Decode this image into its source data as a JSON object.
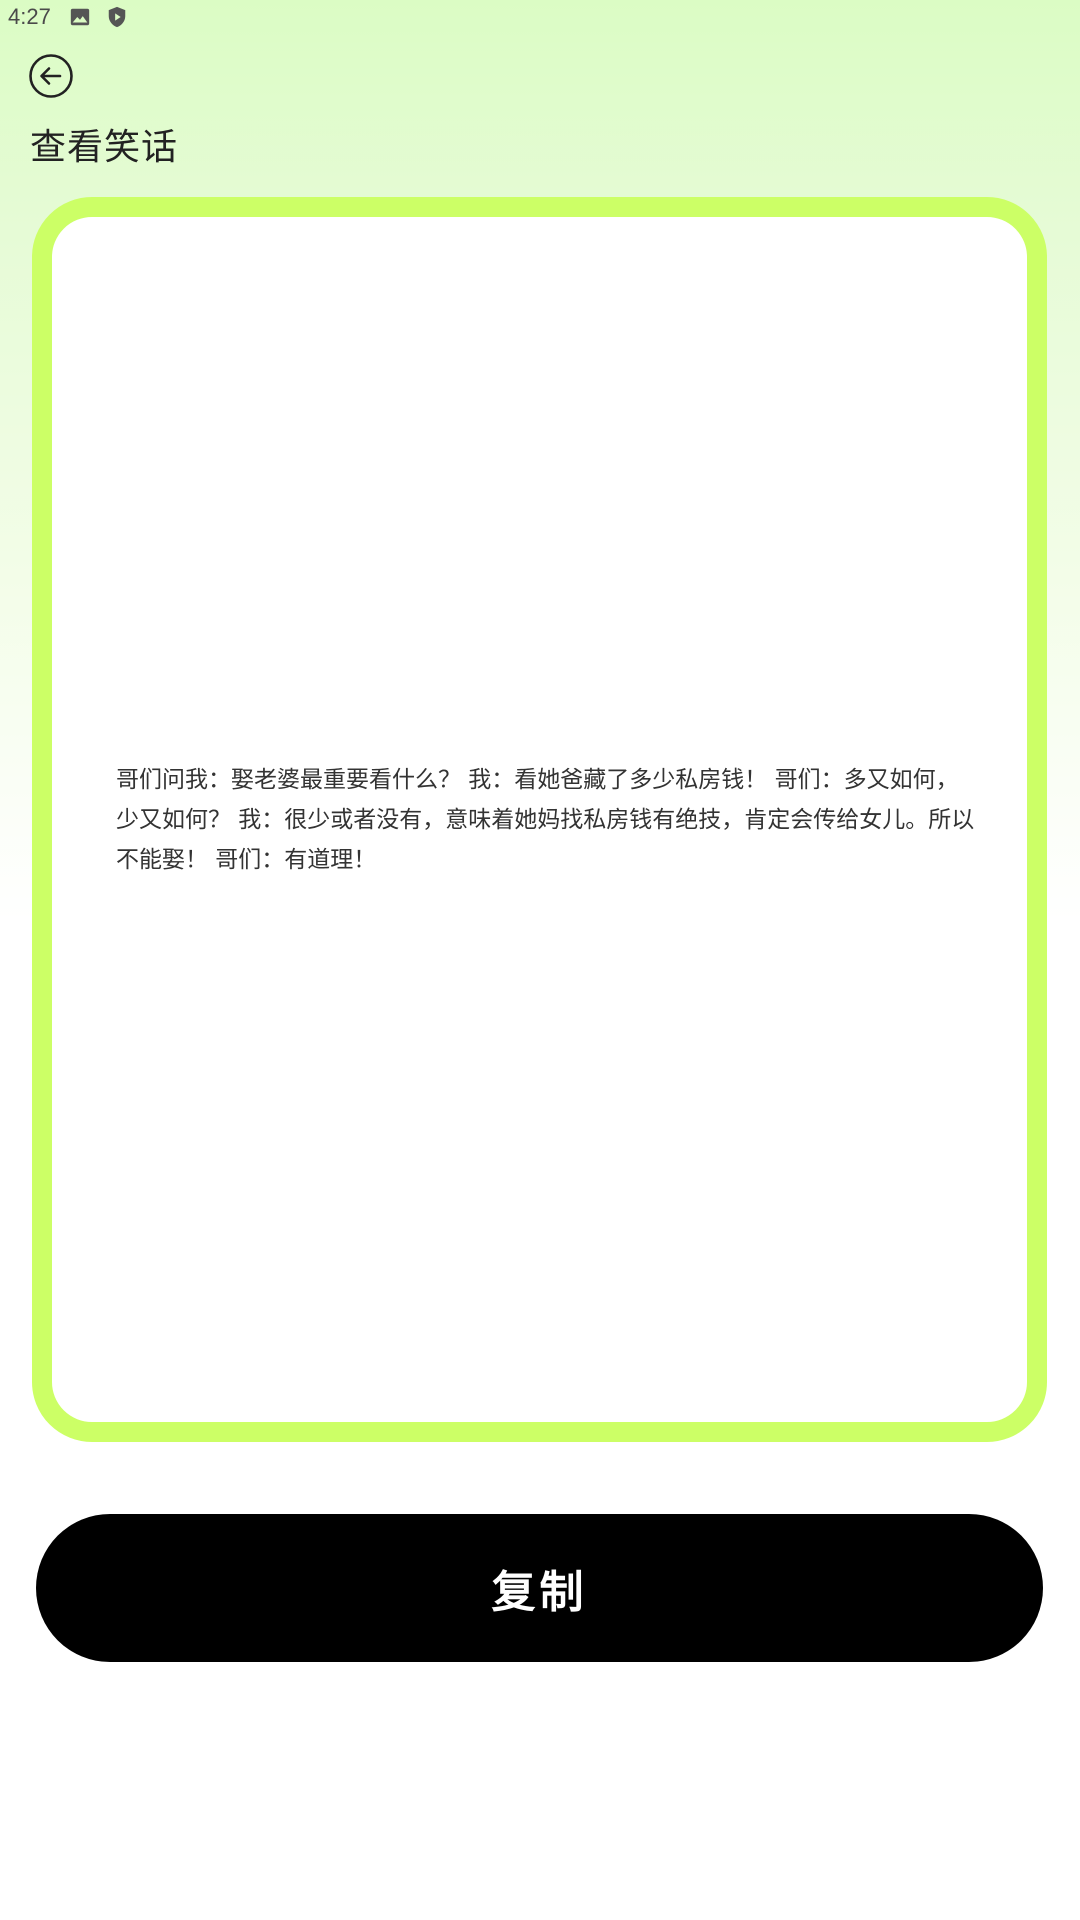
{
  "status_bar": {
    "time": "4:27",
    "icons": [
      "image-icon",
      "shield-play-icon"
    ]
  },
  "header": {
    "back_icon": "arrow-left-circle-icon",
    "title": "查看笑话"
  },
  "joke": {
    "text": "哥们问我：娶老婆最重要看什么？ 我：看她爸藏了多少私房钱！ 哥们：多又如何，少又如何？ 我：很少或者没有，意味着她妈找私房钱有绝技，肯定会传给女儿。所以不能娶！ 哥们：有道理！"
  },
  "actions": {
    "copy_label": "复制"
  },
  "colors": {
    "card_border": "#ccff66",
    "button_bg": "#000000",
    "button_text": "#ffffff",
    "bg_top": "#dbfcc4"
  }
}
